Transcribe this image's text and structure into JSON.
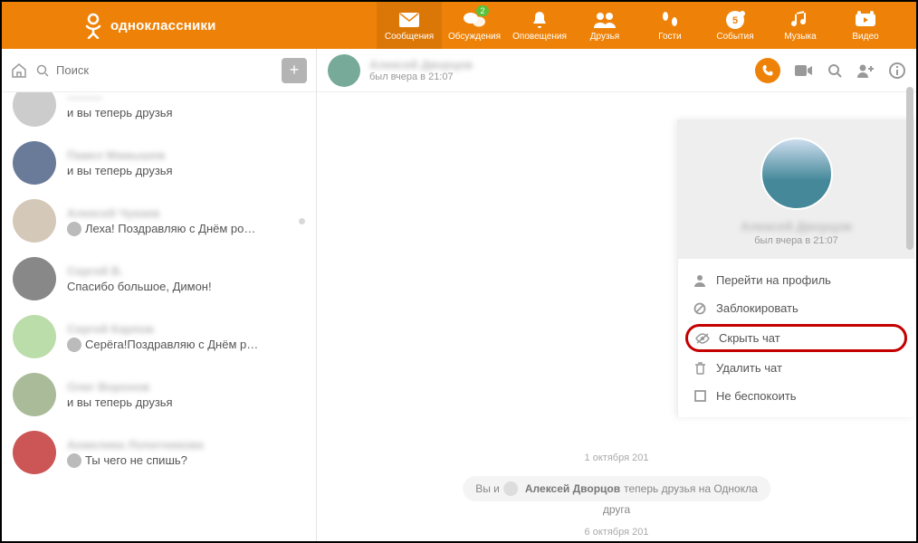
{
  "header": {
    "brand": "одноклассники",
    "nav": [
      {
        "label": "Сообщения",
        "badge": null,
        "active": true
      },
      {
        "label": "Обсуждения",
        "badge": "2",
        "active": false
      },
      {
        "label": "Оповещения",
        "badge": null,
        "active": false
      },
      {
        "label": "Друзья",
        "badge": null,
        "active": false
      },
      {
        "label": "Гости",
        "badge": null,
        "active": false
      },
      {
        "label": "События",
        "badge": null,
        "active": false
      },
      {
        "label": "Музыка",
        "badge": null,
        "active": false
      },
      {
        "label": "Видео",
        "badge": null,
        "active": false
      }
    ]
  },
  "search": {
    "placeholder": "Поиск"
  },
  "conversations": [
    {
      "name": "———",
      "msg": "и вы теперь друзья",
      "icon": false
    },
    {
      "name": "Павел Мамышев",
      "msg": "и вы теперь друзья",
      "icon": false
    },
    {
      "name": "Алексей Чукаев",
      "msg": "Леха! Поздравляю с Днём ро…",
      "icon": true,
      "dot": true
    },
    {
      "name": "Сергей В.",
      "msg": "Спасибо большое, Димон!",
      "icon": false
    },
    {
      "name": "Сергей Карпов",
      "msg": "Серёга!Поздравляю с Днём р…",
      "icon": true
    },
    {
      "name": "Олег Воронов",
      "msg": "и вы теперь друзья",
      "icon": false
    },
    {
      "name": "Анжелика Лопатникова",
      "msg": "Ты чего не спишь?",
      "icon": true
    }
  ],
  "chat": {
    "name": "Алексей Дворцов",
    "status": "был вчера в 21:07",
    "date1": "1 октября 201",
    "sys_prefix": "Вы и",
    "sys_name": "Алексей Дворцов",
    "sys_suffix": "теперь друзья на Однокла",
    "sys_line2": "друга",
    "date2": "6 октября 201"
  },
  "panel": {
    "name": "Алексей Дворцов",
    "status": "был вчера в 21:07",
    "menu": {
      "profile": "Перейти на профиль",
      "block": "Заблокировать",
      "hide": "Скрыть чат",
      "delete": "Удалить чат",
      "dnd": "Не беспокоить"
    }
  }
}
